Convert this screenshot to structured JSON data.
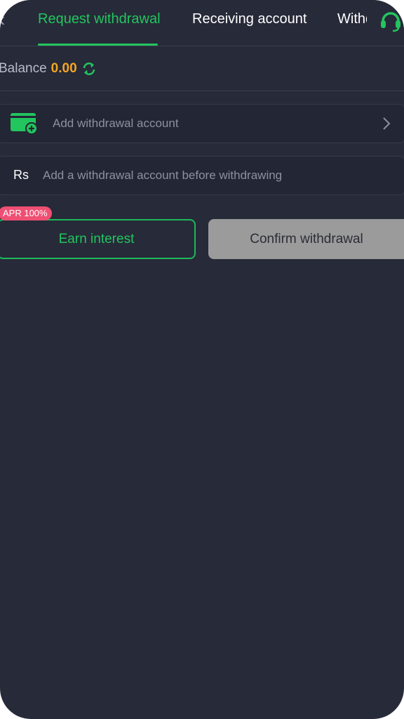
{
  "header": {
    "tabs": [
      {
        "label": "Request withdrawal",
        "active": true
      },
      {
        "label": "Receiving account",
        "active": false
      },
      {
        "label": "Withdrawal records",
        "active": false
      }
    ],
    "back_icon": "chevron-left-icon",
    "support_icon": "headset-icon",
    "accent_color": "#22c55e"
  },
  "balance": {
    "label": "Balance",
    "value": "0.00",
    "value_color": "#f5a623",
    "refresh_icon": "refresh-icon"
  },
  "account": {
    "label": "Add withdrawal account",
    "icon": "wallet-add-icon"
  },
  "amount": {
    "currency": "Rs",
    "placeholder": "Add a withdrawal account before withdrawing",
    "value": ""
  },
  "actions": {
    "earn_label": "Earn interest",
    "badge": "APR 100%",
    "confirm_label": "Confirm withdrawal"
  }
}
